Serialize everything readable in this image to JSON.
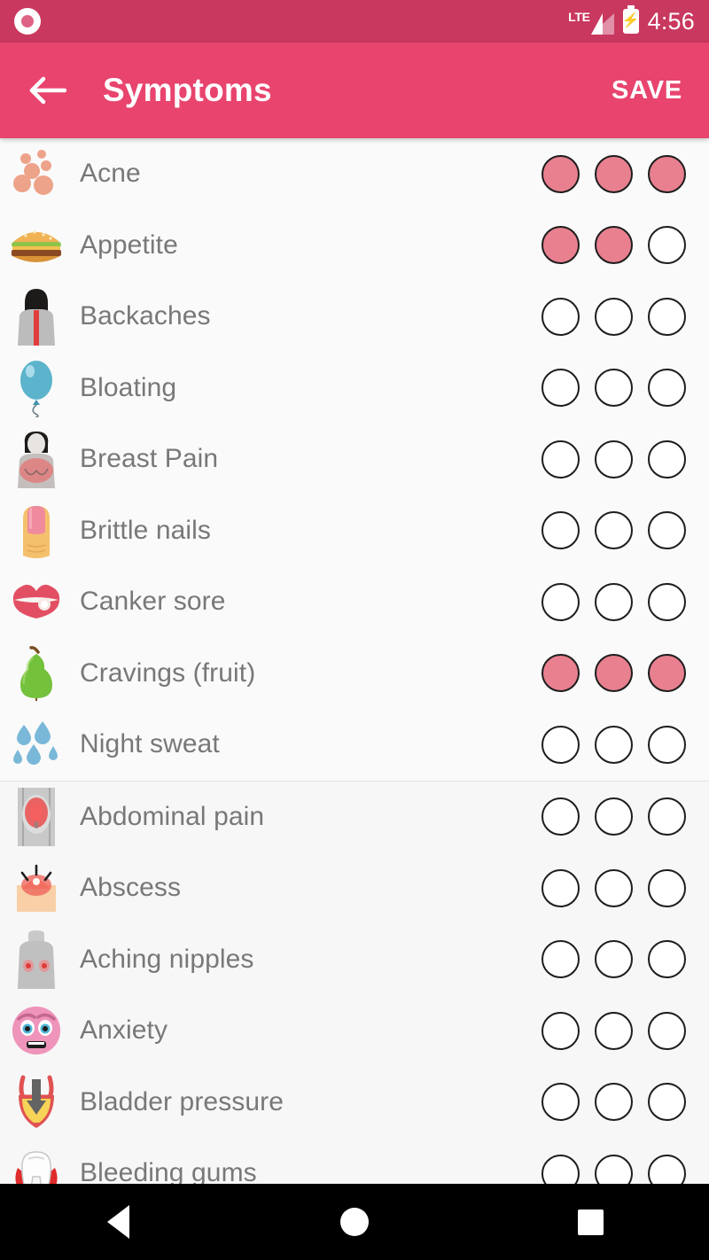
{
  "status_bar": {
    "notification_icon": "record-circle-icon",
    "network_label": "LTE",
    "signal_icon": "signal-triangle-icon",
    "battery_icon": "battery-charging-icon",
    "time": "4:56",
    "background_color": "#c9385f"
  },
  "app_bar": {
    "back_icon": "arrow-left-icon",
    "title": "Symptoms",
    "save_label": "SAVE",
    "background_color": "#e8446e"
  },
  "colors": {
    "accent": "#e8446e",
    "status_bar": "#c9385f",
    "dot_selected": "#e8808f",
    "dot_border": "#1d1d1d",
    "row_text": "#787878",
    "page_background": "#fafafa",
    "section_background": "#f7f7f7"
  },
  "severity_levels": 3,
  "sections": [
    {
      "name": "tracked-symptoms",
      "rows": [
        {
          "label": "Acne",
          "icon": "acne-spots-icon",
          "severity": 3
        },
        {
          "label": "Appetite",
          "icon": "hamburger-icon",
          "severity": 2
        },
        {
          "label": "Backaches",
          "icon": "back-spine-icon",
          "severity": 0
        },
        {
          "label": "Bloating",
          "icon": "balloon-icon",
          "severity": 0
        },
        {
          "label": "Breast Pain",
          "icon": "breast-pain-icon",
          "severity": 0
        },
        {
          "label": "Brittle nails",
          "icon": "fingernail-icon",
          "severity": 0
        },
        {
          "label": "Canker sore",
          "icon": "lips-sore-icon",
          "severity": 0
        },
        {
          "label": "Cravings (fruit)",
          "icon": "pear-icon",
          "severity": 3
        },
        {
          "label": "Night sweat",
          "icon": "sweat-droplets-icon",
          "severity": 0
        }
      ]
    },
    {
      "name": "all-symptoms",
      "rows": [
        {
          "label": "Abdominal pain",
          "icon": "abdominal-pain-icon",
          "severity": 0
        },
        {
          "label": "Abscess",
          "icon": "abscess-icon",
          "severity": 0
        },
        {
          "label": "Aching nipples",
          "icon": "aching-nipples-icon",
          "severity": 0
        },
        {
          "label": "Anxiety",
          "icon": "anxious-face-icon",
          "severity": 0
        },
        {
          "label": "Bladder pressure",
          "icon": "bladder-icon",
          "severity": 0
        },
        {
          "label": "Bleeding gums",
          "icon": "tooth-gums-icon",
          "severity": 0
        }
      ]
    }
  ],
  "nav_bar": {
    "back": "nav-back-triangle-icon",
    "home": "nav-home-circle-icon",
    "recents": "nav-recents-square-icon"
  }
}
